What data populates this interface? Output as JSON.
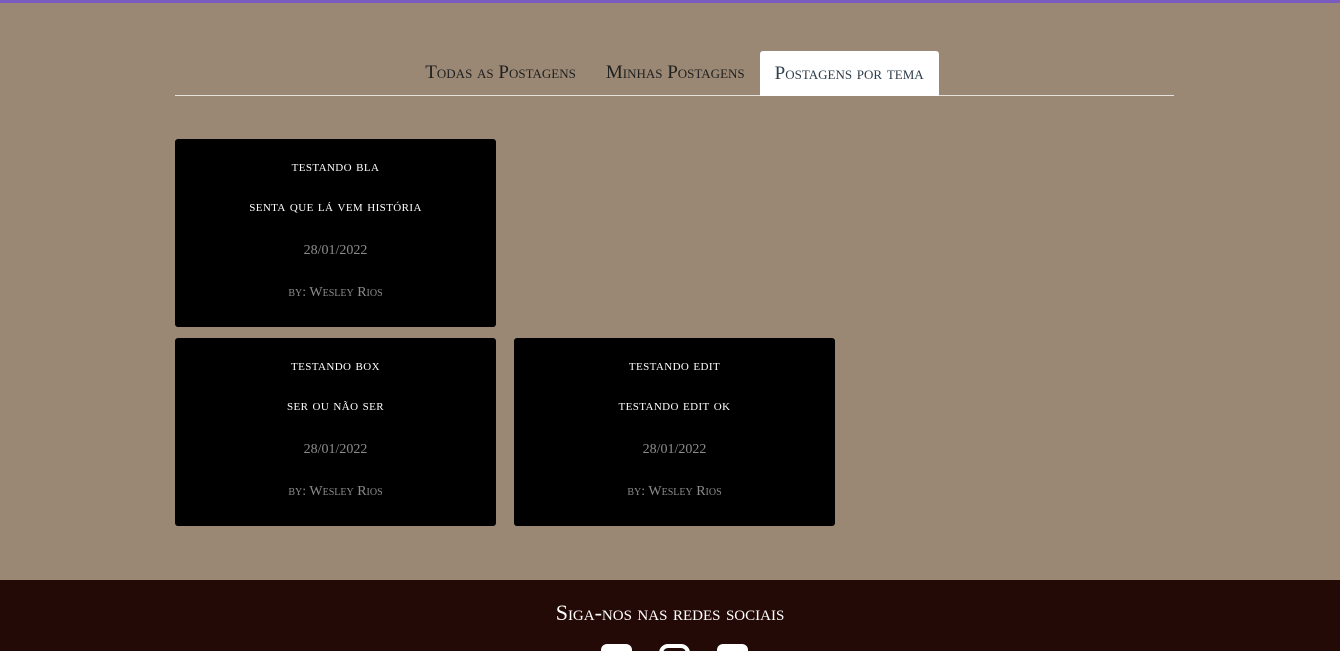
{
  "tabs": [
    {
      "label": "Todas as Postagens"
    },
    {
      "label": "Minhas Postagens"
    },
    {
      "label": "Postagens por tema"
    }
  ],
  "posts": [
    {
      "theme": "TESTANDO BLA",
      "title": "SENTA QUE LÁ VEM HISTÓRIA",
      "date": "28/01/2022",
      "author": "by: Wesley Rios"
    },
    {
      "theme": "TESTANDO BOX",
      "title": "SER OU NÃO SER",
      "date": "28/01/2022",
      "author": "by: Wesley Rios"
    },
    {
      "theme": "TESTANDO EDIT",
      "title": "TESTANDO EDIT OK",
      "date": "28/01/2022",
      "author": "by: Wesley Rios"
    }
  ],
  "footer": {
    "title": "Siga-nos nas redes sociais",
    "icons": [
      "facebook-icon",
      "instagram-icon",
      "linkedin-icon"
    ]
  },
  "colors": {
    "background": "#9a8874",
    "footer": "#240a06",
    "card": "#000000",
    "accent_bar": "#7a5bbf"
  }
}
